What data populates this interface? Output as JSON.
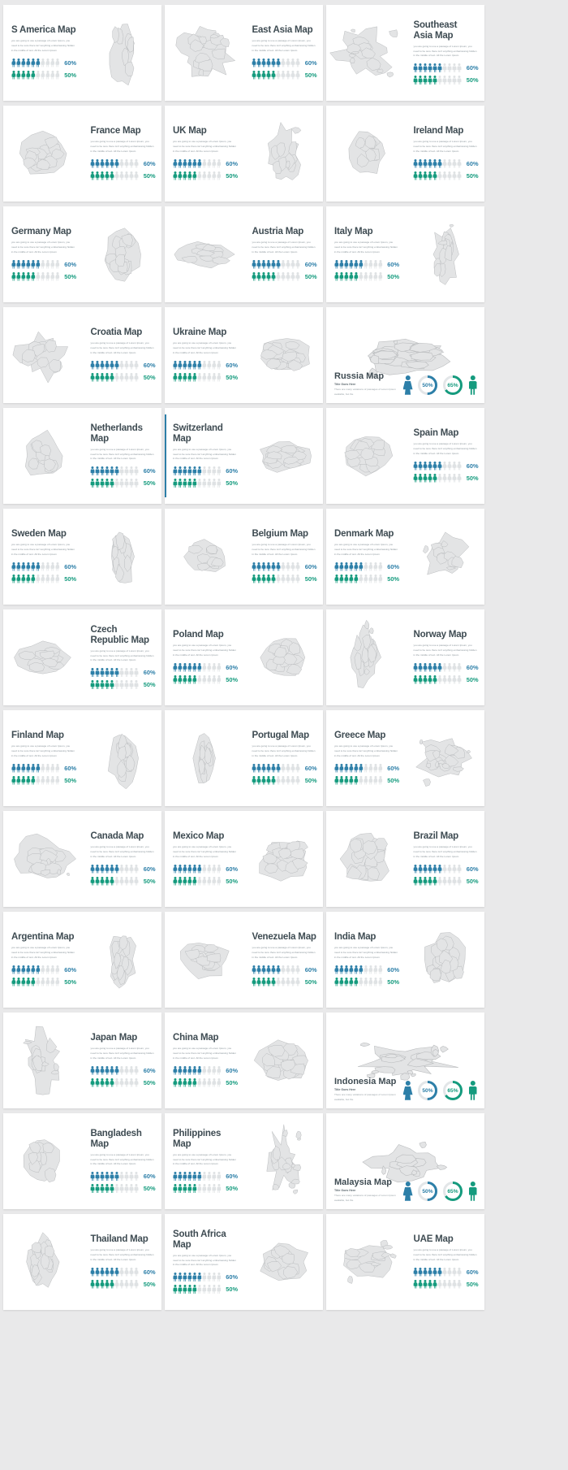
{
  "meta": {
    "blurb": "you are going to use a passage of Lorem Ipsum, you need to be sure there isn't anything embarrassing hidden in the middle of text. All the Lorem Ipsum",
    "subtitle": "Title Goes Here",
    "wide_blurb": "There are many variations of passages of Lorem Ipsum available, but the",
    "colors": {
      "blue": "#2d7fa8",
      "green": "#159b7e",
      "off": "#dfe2e4",
      "map_fill": "#e3e4e5",
      "map_stroke": "#b9bbbd",
      "title": "#3e4b52"
    },
    "stat_blue_label": "60%",
    "stat_green_label": "50%",
    "stat_blue_value": 60,
    "stat_green_value": 50,
    "donut_blue_label": "50%",
    "donut_green_label": "65%",
    "donut_blue_value": 50,
    "donut_green_value": 65
  },
  "cards": [
    {
      "title": "S America Map",
      "side": "left",
      "map": "s-america",
      "type": "standard"
    },
    {
      "title": "East Asia Map",
      "side": "right",
      "map": "east-asia",
      "type": "standard"
    },
    {
      "title": "Southeast Asia Map",
      "side": "right",
      "map": "southeast-asia",
      "type": "standard"
    },
    {
      "title": "France Map",
      "side": "right",
      "map": "france",
      "type": "standard"
    },
    {
      "title": "UK Map",
      "side": "left",
      "map": "uk",
      "type": "standard"
    },
    {
      "title": "Ireland Map",
      "side": "right",
      "map": "ireland",
      "type": "standard"
    },
    {
      "title": "Germany Map",
      "side": "left",
      "map": "germany",
      "type": "standard"
    },
    {
      "title": "Austria Map",
      "side": "right",
      "map": "austria",
      "type": "standard"
    },
    {
      "title": "Italy Map",
      "side": "left",
      "map": "italy",
      "type": "standard"
    },
    {
      "title": "Croatia Map",
      "side": "right",
      "map": "croatia",
      "type": "standard"
    },
    {
      "title": "Ukraine Map",
      "side": "left",
      "map": "ukraine",
      "type": "standard"
    },
    {
      "title": "Russia Map",
      "side": "wide",
      "map": "russia",
      "type": "wide"
    },
    {
      "title": "Netherlands Map",
      "side": "right",
      "map": "netherlands",
      "type": "standard"
    },
    {
      "title": "Switzerland Map",
      "side": "left",
      "map": "switzerland",
      "type": "standard",
      "accent": true
    },
    {
      "title": "Spain Map",
      "side": "right",
      "map": "spain",
      "type": "standard"
    },
    {
      "title": "Sweden Map",
      "side": "left",
      "map": "sweden",
      "type": "standard"
    },
    {
      "title": "Belgium Map",
      "side": "right",
      "map": "belgium",
      "type": "standard"
    },
    {
      "title": "Denmark Map",
      "side": "left",
      "map": "denmark",
      "type": "standard"
    },
    {
      "title": "Czech Republic Map",
      "side": "right",
      "map": "czech",
      "type": "standard"
    },
    {
      "title": "Poland Map",
      "side": "left",
      "map": "poland",
      "type": "standard"
    },
    {
      "title": "Norway Map",
      "side": "right",
      "map": "norway",
      "type": "standard"
    },
    {
      "title": "Finland Map",
      "side": "left",
      "map": "finland",
      "type": "standard"
    },
    {
      "title": "Portugal Map",
      "side": "right",
      "map": "portugal",
      "type": "standard"
    },
    {
      "title": "Greece Map",
      "side": "left",
      "map": "greece",
      "type": "standard"
    },
    {
      "title": "Canada Map",
      "side": "right",
      "map": "canada",
      "type": "standard"
    },
    {
      "title": "Mexico Map",
      "side": "left",
      "map": "mexico",
      "type": "standard"
    },
    {
      "title": "Brazil Map",
      "side": "right",
      "map": "brazil",
      "type": "standard"
    },
    {
      "title": "Argentina Map",
      "side": "left",
      "map": "argentina",
      "type": "standard"
    },
    {
      "title": "Venezuela Map",
      "side": "right",
      "map": "venezuela",
      "type": "standard"
    },
    {
      "title": "India Map",
      "side": "left",
      "map": "india",
      "type": "standard"
    },
    {
      "title": "Japan Map",
      "side": "right",
      "map": "japan",
      "type": "standard"
    },
    {
      "title": "China Map",
      "side": "left",
      "map": "china",
      "type": "standard"
    },
    {
      "title": "Indonesia Map",
      "side": "wide",
      "map": "indonesia",
      "type": "wide"
    },
    {
      "title": "Bangladesh Map",
      "side": "right",
      "map": "bangladesh",
      "type": "standard"
    },
    {
      "title": "Philippines Map",
      "side": "left",
      "map": "philippines",
      "type": "standard"
    },
    {
      "title": "Malaysia Map",
      "side": "wide",
      "map": "malaysia",
      "type": "wide"
    },
    {
      "title": "Thailand Map",
      "side": "right",
      "map": "thailand",
      "type": "standard"
    },
    {
      "title": "South Africa Map",
      "side": "left",
      "map": "south-africa",
      "type": "standard"
    },
    {
      "title": "UAE Map",
      "side": "right",
      "map": "uae",
      "type": "standard"
    }
  ]
}
